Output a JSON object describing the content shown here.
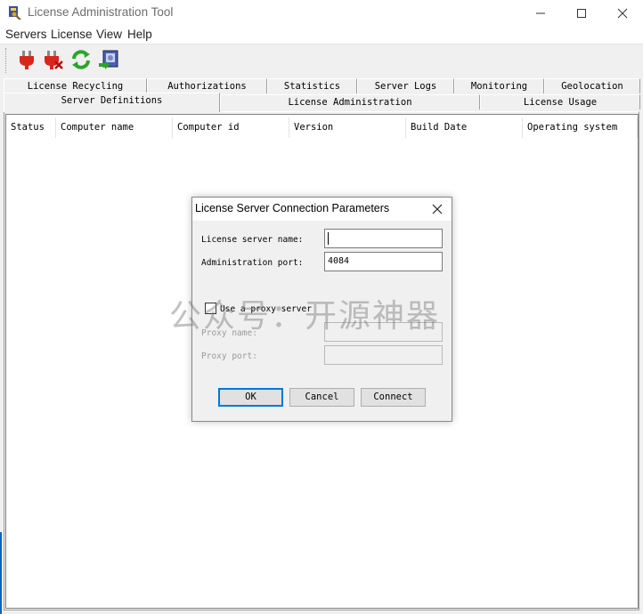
{
  "window": {
    "title": "License Administration Tool",
    "app_icon": "license-tool-icon"
  },
  "menu": [
    "Servers",
    "License",
    "View",
    "Help"
  ],
  "toolbar": {
    "buttons": [
      {
        "icon": "plug-connect-icon"
      },
      {
        "icon": "plug-disconnect-icon"
      },
      {
        "icon": "refresh-icon"
      },
      {
        "icon": "server-export-icon"
      }
    ]
  },
  "tabs": {
    "row1": [
      "License Recycling",
      "Authorizations",
      "Statistics",
      "Server Logs",
      "Monitoring",
      "Geolocation"
    ],
    "row2": [
      "Server Definitions",
      "License Administration",
      "License Usage"
    ],
    "active": "Server Definitions"
  },
  "table": {
    "columns": [
      "Status",
      "Computer name",
      "Computer id",
      "Version",
      "Build Date",
      "Operating system"
    ],
    "rows": []
  },
  "dialog": {
    "title": "License Server Connection Parameters",
    "server_name_label": "License server name:",
    "server_name_value": "",
    "admin_port_label": "Administration port:",
    "admin_port_value": "4084",
    "proxy_checkbox_label": "Use a proxy server",
    "proxy_checked": false,
    "proxy_name_label": "Proxy name:",
    "proxy_port_label": "Proxy port:",
    "ok_label": "OK",
    "cancel_label": "Cancel",
    "connect_label": "Connect"
  },
  "watermark": "公众号：开源神器",
  "colors": {
    "accent": "#0078d7",
    "plug_red": "#d9261c",
    "refresh_green": "#2aa52a"
  }
}
